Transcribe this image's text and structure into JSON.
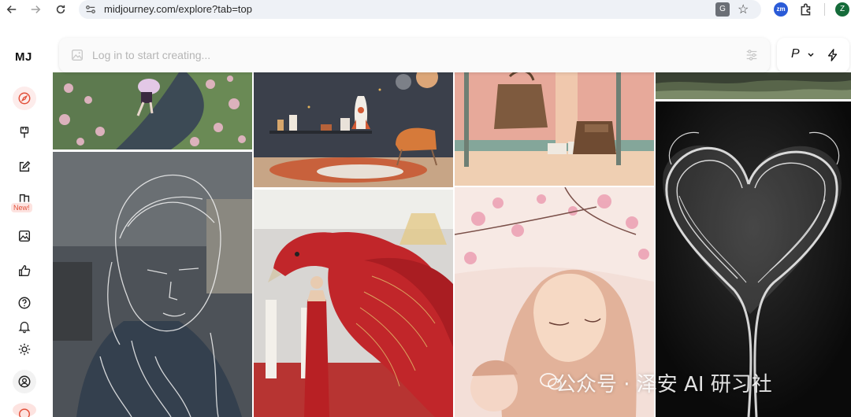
{
  "browser": {
    "url": "midjourney.com/explore?tab=top",
    "translate_icon": "translate-icon",
    "extension_badge": "zm",
    "profile_initial": "Z"
  },
  "sidebar": {
    "logo": "MJ",
    "items": [
      {
        "name": "explore",
        "icon": "compass-icon",
        "active": true
      },
      {
        "name": "create",
        "icon": "brush-icon"
      },
      {
        "name": "edit",
        "icon": "edit-icon"
      },
      {
        "name": "personalize",
        "icon": "pages-icon",
        "badge": "New!"
      },
      {
        "name": "organize",
        "icon": "image-icon"
      },
      {
        "name": "ratings",
        "icon": "thumbs-up-icon"
      },
      {
        "name": "help",
        "icon": "help-icon"
      },
      {
        "name": "updates",
        "icon": "bell-icon"
      },
      {
        "name": "theme",
        "icon": "sun-icon"
      },
      {
        "name": "account",
        "icon": "user-circle-icon"
      }
    ]
  },
  "prompt": {
    "placeholder": "Log in to start creating..."
  },
  "mode": {
    "label": "P"
  },
  "gallery": {
    "images": [
      "flower-field-child",
      "kids-room-rocket",
      "backpack-legs",
      "forest-strip",
      "wireframe-portrait",
      "red-phoenix",
      "hijab-mother-baby",
      "smoke-heart"
    ]
  },
  "watermark": {
    "text": "公众号 · 泽安 AI 研习社"
  },
  "colors": {
    "accent": "#e2503a",
    "brand_badge": "#2a5bd7",
    "avatar": "#156b3a"
  }
}
